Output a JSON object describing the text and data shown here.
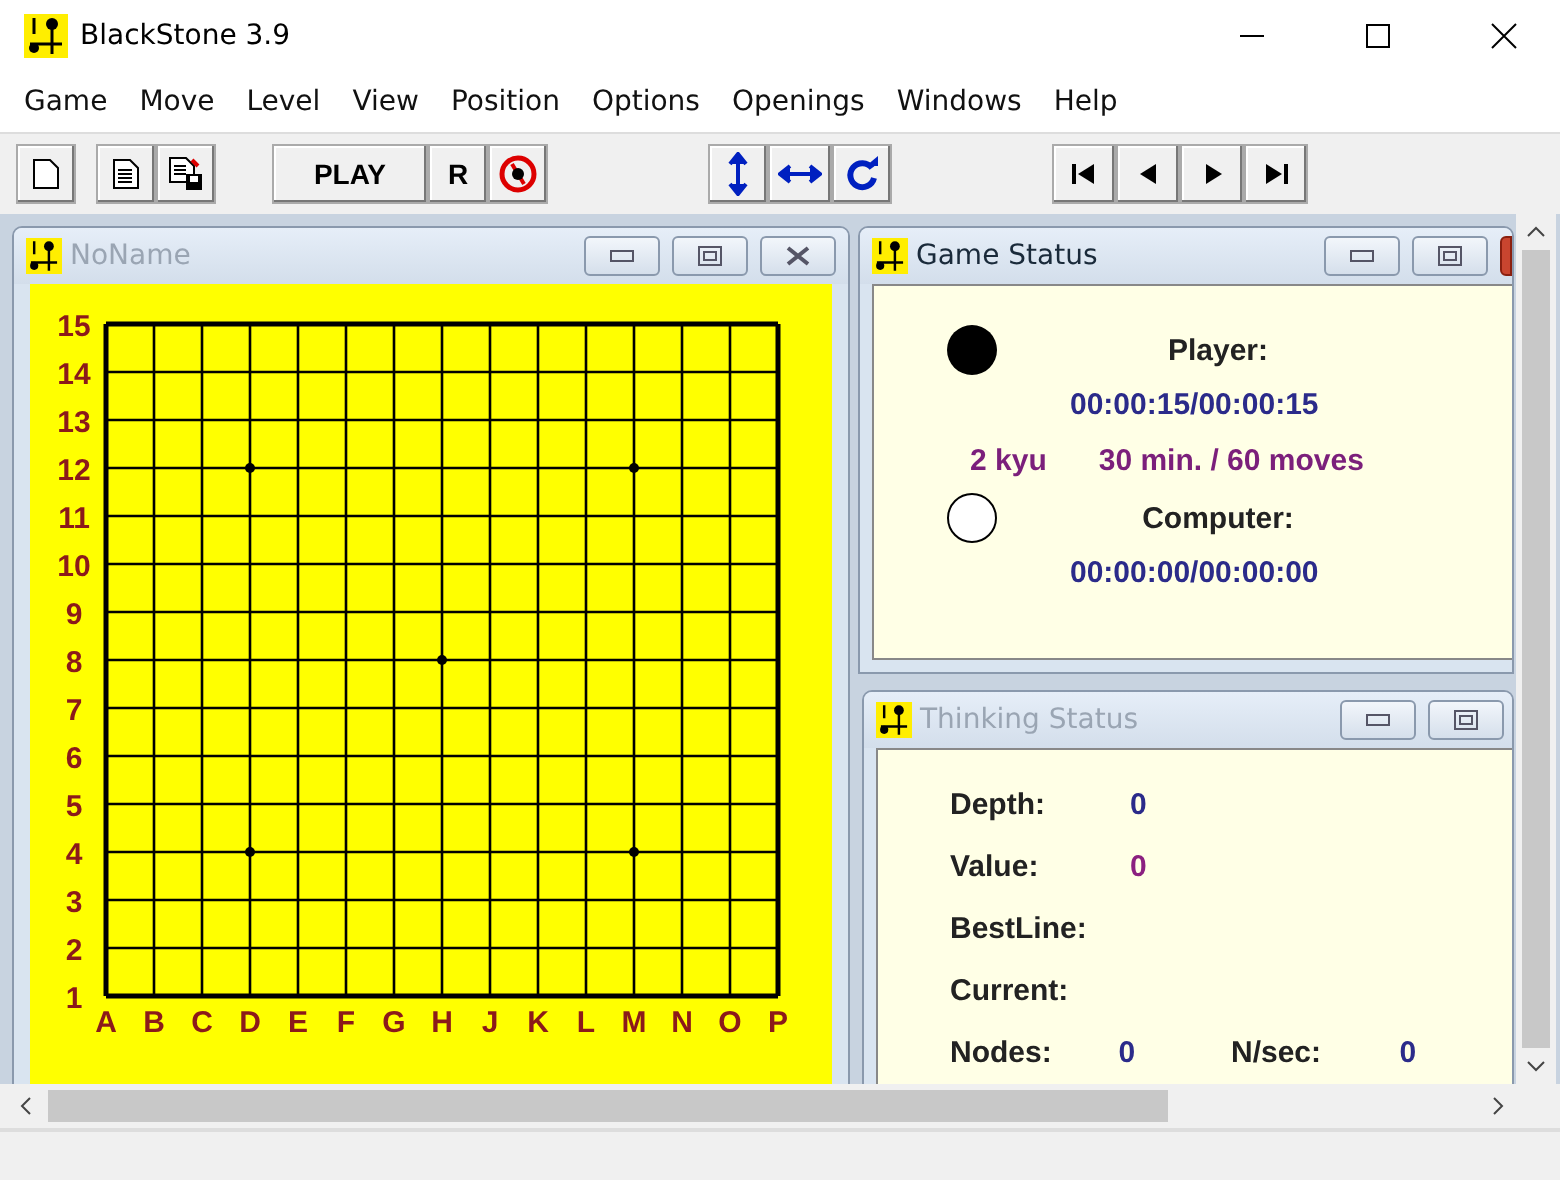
{
  "window": {
    "title": "BlackStone 3.9"
  },
  "menu": [
    "Game",
    "Move",
    "Level",
    "View",
    "Position",
    "Options",
    "Openings",
    "Windows",
    "Help"
  ],
  "toolbar": {
    "play_label": "PLAY",
    "r_label": "R"
  },
  "board_window": {
    "title": "NoName",
    "active": false,
    "row_labels": [
      "15",
      "14",
      "13",
      "12",
      "11",
      "10",
      "9",
      "8",
      "7",
      "6",
      "5",
      "4",
      "3",
      "2",
      "1"
    ],
    "column_labels": [
      "A",
      "B",
      "C",
      "D",
      "E",
      "F",
      "G",
      "H",
      "J",
      "K",
      "L",
      "M",
      "N",
      "O",
      "P"
    ]
  },
  "game_status": {
    "title": "Game Status",
    "active": true,
    "player_label": "Player:",
    "player_time": "00:00:15/00:00:15",
    "level": "2 kyu",
    "time_control": "30 min. / 60 moves",
    "computer_label": "Computer:",
    "computer_time": "00:00:00/00:00:00"
  },
  "thinking_status": {
    "title": "Thinking Status",
    "active": false,
    "fields": [
      {
        "label": "Depth:",
        "value": "0",
        "kind": "count"
      },
      {
        "label": "Value:",
        "value": "0",
        "kind": "score"
      },
      {
        "label": "BestLine:",
        "kind": "empty"
      },
      {
        "label": "Current:",
        "kind": "empty"
      }
    ],
    "bottom_fields": [
      {
        "label": "Nodes:",
        "value": "0"
      },
      {
        "label": "N/sec:",
        "value": "0"
      }
    ]
  }
}
